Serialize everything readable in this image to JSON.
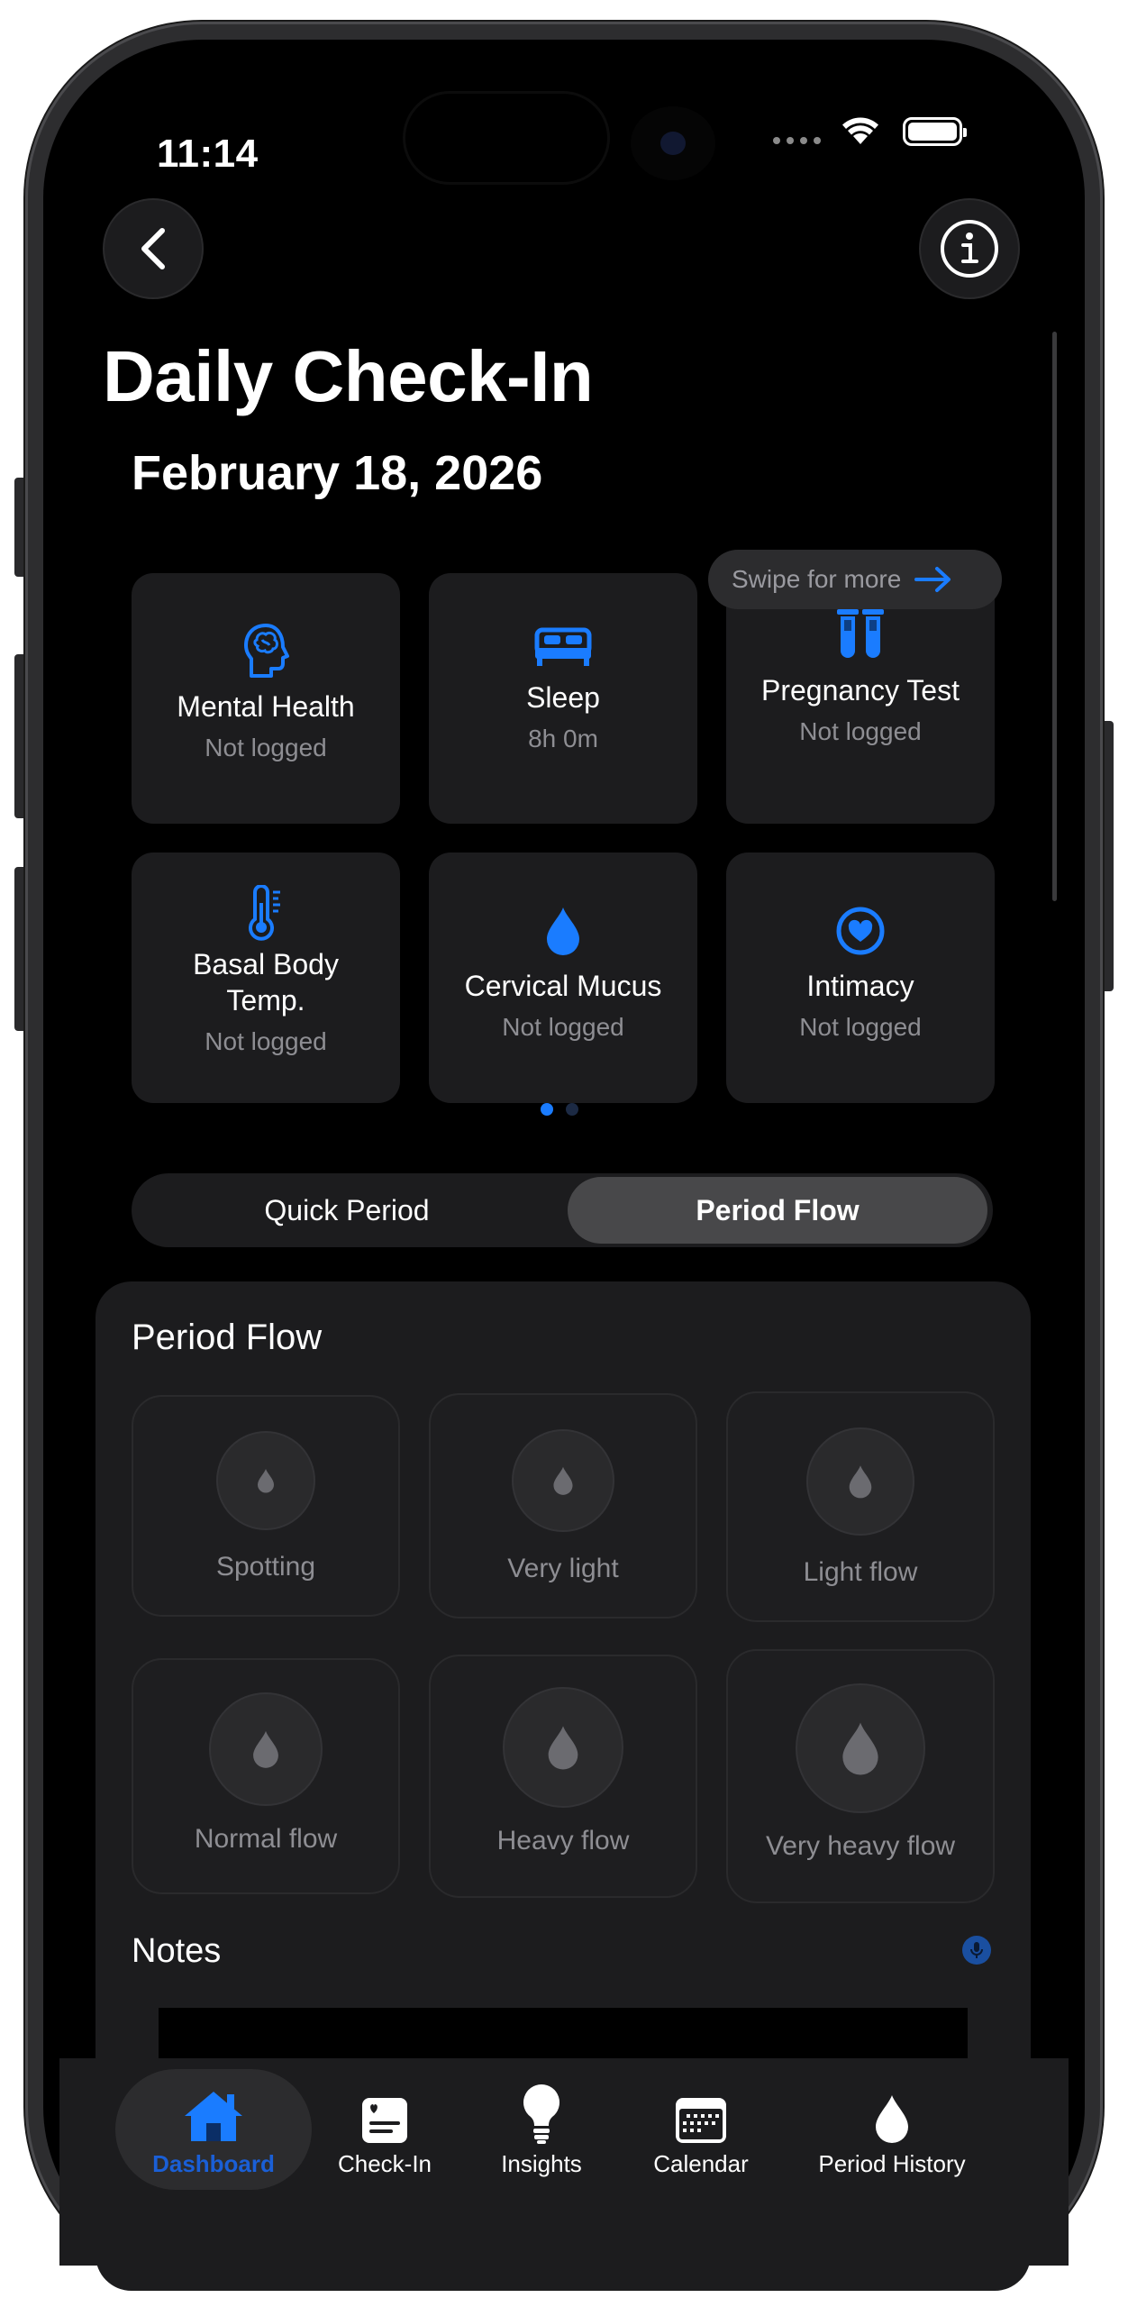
{
  "status": {
    "time": "11:14"
  },
  "header": {
    "title": "Daily Check-In",
    "date": "February 18, 2026"
  },
  "swipe_hint": "Swipe for more",
  "accent": "#1a7cff",
  "tiles": [
    {
      "label": "Mental Health",
      "sub": "Not logged",
      "icon": "brain-head-icon"
    },
    {
      "label": "Sleep",
      "sub": "8h 0m",
      "icon": "bed-icon"
    },
    {
      "label": "Pregnancy Test",
      "sub": "Not logged",
      "icon": "test-tubes-icon"
    },
    {
      "label": "Basal Body Temp.",
      "sub": "Not logged",
      "icon": "thermometer-icon"
    },
    {
      "label": "Cervical Mucus",
      "sub": "Not logged",
      "icon": "drop-icon"
    },
    {
      "label": "Intimacy",
      "sub": "Not logged",
      "icon": "heart-circle-icon"
    }
  ],
  "segment": {
    "left": "Quick Period",
    "right": "Period Flow",
    "selected": "Period Flow"
  },
  "flow_card": {
    "title": "Period Flow",
    "options": [
      "Spotting",
      "Very light",
      "Light flow",
      "Normal flow",
      "Heavy flow",
      "Very heavy flow"
    ]
  },
  "notes": {
    "label": "Notes"
  },
  "tabbar": {
    "items": [
      {
        "label": "Dashboard",
        "icon": "house-icon",
        "active": true
      },
      {
        "label": "Check-In",
        "icon": "checkin-icon",
        "active": false
      },
      {
        "label": "Insights",
        "icon": "lightbulb-icon",
        "active": false
      },
      {
        "label": "Calendar",
        "icon": "calendar-icon",
        "active": false
      },
      {
        "label": "Period History",
        "icon": "drop-icon",
        "active": false
      }
    ]
  }
}
